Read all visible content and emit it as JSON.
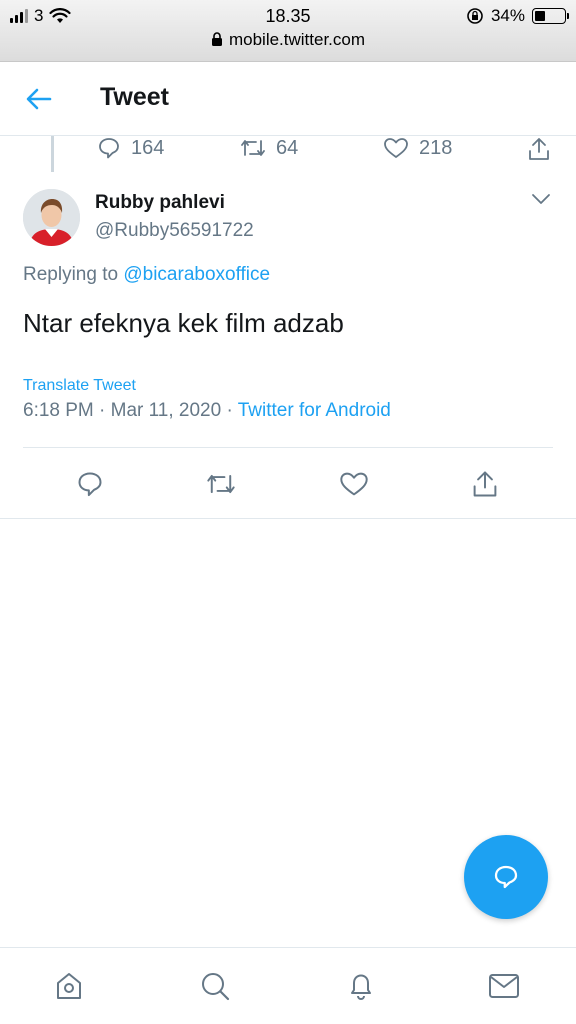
{
  "status_bar": {
    "carrier": "3",
    "time": "18.35",
    "battery_percent": "34%",
    "battery_level": 0.34,
    "url": "mobile.twitter.com"
  },
  "header": {
    "title": "Tweet",
    "back_icon": "arrow-left-icon"
  },
  "parent_tweet": {
    "replies": "164",
    "retweets": "64",
    "likes": "218"
  },
  "tweet": {
    "author_name": "Rubby pahlevi",
    "author_handle": "@Rubby56591722",
    "replying_prefix": "Replying to",
    "replying_to": "@bicaraboxoffice",
    "text": "Ntar efeknya kek film adzab",
    "translate_label": "Translate Tweet",
    "timestamp": "6:18 PM · Mar 11, 2020 ·",
    "source": "Twitter for Android"
  },
  "actions": {
    "icons": [
      "reply-icon",
      "retweet-icon",
      "like-icon",
      "share-icon"
    ]
  },
  "bottom_nav": {
    "icons": [
      "home-icon",
      "search-icon",
      "notifications-icon",
      "messages-icon"
    ]
  },
  "colors": {
    "accent": "#1da1f2",
    "secondary_text": "#657786",
    "border": "#e1e8ed"
  }
}
